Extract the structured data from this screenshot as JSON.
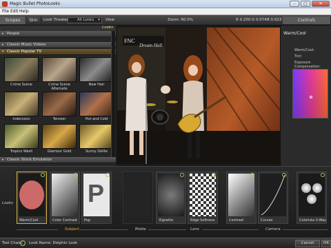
{
  "window": {
    "title": "Magic Bullet PhotoLooks",
    "minimize": "–",
    "maximize": "□",
    "close": "✕"
  },
  "menu": {
    "file": "File",
    "edit": "Edit",
    "help": "Help"
  },
  "toolbar": {
    "scopes": "Scopes",
    "skin": "Skin",
    "look_theater": "Look Theater",
    "looks_filter": "All Looks",
    "view": "View",
    "zoom": "Zoom:  60.0%",
    "r": "R  0.250",
    "g": "G  0.074",
    "b": "B  0.023",
    "controls": "Controls"
  },
  "left_panel": {
    "header": "Looks",
    "categories": [
      "People",
      "Classic Music Videos",
      "Classic Popular TV",
      "Classic Stock Emulation"
    ],
    "thumbnails": [
      "Crime Scene",
      "Crime Scene Alternate",
      "New Hair",
      "Indecision",
      "Tension",
      "Hot and Cold",
      "Tropico Wash",
      "Glamour Gold",
      "Sunny Delite"
    ]
  },
  "viewer": {
    "banner": "FNC",
    "banner2": "Dream Hall"
  },
  "right_panel": {
    "title": "Warm/Cool",
    "rows": [
      "Warm/Cool:",
      "Tint:",
      "Exposure Compensation:"
    ]
  },
  "tools": {
    "side_label": "Looks",
    "items": [
      "Warm/Cool",
      "Color Contrast",
      "Pop",
      "",
      "Vignette",
      "Edge Softness",
      "Contrast",
      "Curves",
      "Colorista 3-Way"
    ],
    "categories": [
      "Subject",
      "Matte",
      "Lens",
      "Camera"
    ]
  },
  "status": {
    "tool_chain": "Tool Chain:",
    "look_name": "Look Name:  Dolphin Look",
    "cancel": "Cancel",
    "ok": "OK"
  },
  "colors": {
    "accent": "#e0b840",
    "selected": "#6e5a2f"
  }
}
